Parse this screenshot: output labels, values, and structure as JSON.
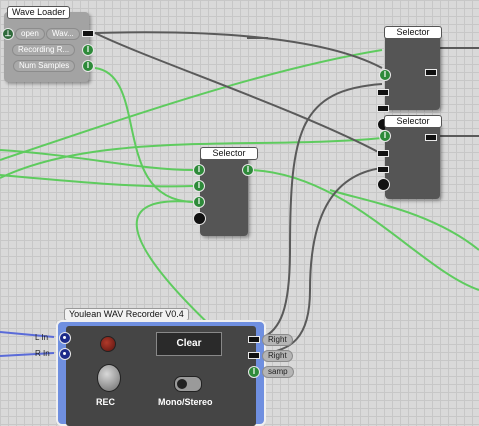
{
  "wave_loader": {
    "title": "Wave Loader",
    "open_label": "open",
    "wav_label": "Wav...",
    "recording_label": "Recording R...",
    "num_samples_label": "Num Samples"
  },
  "selector_top": {
    "title": "Selector"
  },
  "selector_mid": {
    "title": "Selector"
  },
  "selector_center": {
    "title": "Selector"
  },
  "recorder": {
    "title": "Youlean WAV Recorder V0.4",
    "clear_label": "Clear",
    "rec_label": "REC",
    "mono_stereo_label": "Mono/Stereo",
    "l_in_label": "L In",
    "r_in_label": "R In",
    "right_label_1": "Right",
    "right_label_2": "Right",
    "samp_label": "samp"
  },
  "colors": {
    "wire_gray": "#5a5a5a",
    "wire_green": "#5ecb5e",
    "wire_blue": "#5a6bd8",
    "module_body": "#555555",
    "recorder_frame": "#6f8fe0"
  }
}
